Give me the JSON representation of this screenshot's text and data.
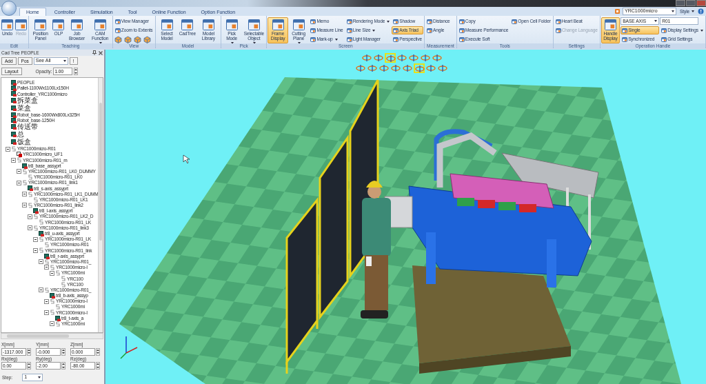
{
  "app_bar": {
    "controller": "YRC1000micro",
    "style": "Style"
  },
  "tabs": [
    {
      "label": "Home",
      "selected": true
    },
    {
      "label": "Controller",
      "selected": false
    },
    {
      "label": "Simulation",
      "selected": false
    },
    {
      "label": "Tool",
      "selected": false
    },
    {
      "label": "Online Function",
      "selected": false
    },
    {
      "label": "Option Function",
      "selected": false
    }
  ],
  "ribbon": [
    {
      "label": "Edit",
      "items": [
        {
          "label": "Undo",
          "kind": "large",
          "disabled": false
        },
        {
          "label": "Redo",
          "kind": "large",
          "disabled": true
        }
      ]
    },
    {
      "label": "Teaching",
      "items": [
        {
          "label": "Position Panel",
          "kind": "large"
        },
        {
          "label": "OLP",
          "kind": "large"
        },
        {
          "label": "Job Browser",
          "kind": "large"
        },
        {
          "label": "CAM Function",
          "kind": "large",
          "menu": true
        }
      ]
    },
    {
      "label": "View",
      "items": [
        {
          "label": "View Manager",
          "kind": "small"
        },
        {
          "label": "Zoom to Extents",
          "kind": "small"
        },
        {
          "kind": "icons"
        }
      ]
    },
    {
      "label": "Model",
      "items": [
        {
          "label": "Select Model",
          "kind": "large"
        },
        {
          "label": "CadTree",
          "kind": "large"
        },
        {
          "label": "Model Library",
          "kind": "large"
        }
      ]
    },
    {
      "label": "Pick",
      "items": [
        {
          "label": "Pick Mode",
          "kind": "large",
          "menu": true
        },
        {
          "label": "Selectable Object",
          "kind": "large",
          "menu": true
        }
      ]
    },
    {
      "label": "Screen",
      "items": [
        {
          "label": "Frame Display",
          "kind": "large",
          "selected": true
        },
        {
          "label": "Cutting Plane",
          "kind": "large",
          "menu": true
        },
        {
          "label": "Memo",
          "kind": "small"
        },
        {
          "label": "Measure Line",
          "kind": "small"
        },
        {
          "label": "Mark-up",
          "kind": "small",
          "menu": true
        },
        {
          "label": "Rendering Mode",
          "kind": "small",
          "menu": true
        },
        {
          "label": "Line Size",
          "kind": "small",
          "menu": true
        },
        {
          "label": "Light Manager",
          "kind": "small"
        },
        {
          "label": "Shadow",
          "kind": "small",
          "selected": false
        },
        {
          "label": "Axis Triad",
          "kind": "small",
          "selected": true
        },
        {
          "label": "Perspective",
          "kind": "small",
          "selected": false
        }
      ]
    },
    {
      "label": "Measurement",
      "items": [
        {
          "label": "Distance",
          "kind": "small"
        },
        {
          "label": "Angle",
          "kind": "small"
        }
      ]
    },
    {
      "label": "Tools",
      "items": [
        {
          "label": "Copy",
          "kind": "small"
        },
        {
          "label": "Measure Performance",
          "kind": "small"
        },
        {
          "label": "Execute Soft",
          "kind": "small"
        },
        {
          "label": "Open Cell Folder",
          "kind": "small"
        }
      ]
    },
    {
      "label": "Settings",
      "items": [
        {
          "label": "Heart Beat",
          "kind": "small",
          "disabled": false
        },
        {
          "label": "Change Language",
          "kind": "small",
          "disabled": true
        }
      ]
    },
    {
      "label": "Operation Handle",
      "items": [
        {
          "label": "Handle Display",
          "kind": "large",
          "selected": true
        },
        {
          "label": "BASE AXIS",
          "kind": "combo"
        },
        {
          "label": "Single",
          "kind": "small",
          "selected": true
        },
        {
          "label": "Synchronized",
          "kind": "small",
          "selected": false
        },
        {
          "label": "R01",
          "kind": "field"
        },
        {
          "label": "Display Settings",
          "kind": "small",
          "menu": true
        },
        {
          "label": "Grid Settings",
          "kind": "small"
        }
      ]
    }
  ],
  "cad_tree": {
    "title": "Cad Tree PEOPLE",
    "add": "Add",
    "pos": "Pos",
    "filter": "See All",
    "info": "!",
    "layout": "Layout",
    "opacity_label": "Opacity:",
    "opacity": "1.00",
    "items": [
      {
        "label": "PEOPLE",
        "kind": "part"
      },
      {
        "label": "Pallet-1100Wx1100Lx150H",
        "kind": "part"
      },
      {
        "label": "Controller_YRC1000micro",
        "kind": "part"
      },
      {
        "label": "拆菜盒",
        "kind": "part"
      },
      {
        "label": "菜盒",
        "kind": "part"
      },
      {
        "label": "Robot_base-1600Wx800Lx325H",
        "kind": "part"
      },
      {
        "label": "Robot_base-1250H",
        "kind": "part"
      },
      {
        "label": "传送带",
        "kind": "part"
      },
      {
        "label": "总",
        "kind": "part"
      },
      {
        "label": "饭盒",
        "kind": "part"
      },
      {
        "label": "YRC1000micro-R01",
        "kind": "frame",
        "expanded": true,
        "children": [
          {
            "label": "YRC1000micro_UF1",
            "kind": "user-frame"
          },
          {
            "label": "YRC1000micro-R01_m",
            "kind": "frame",
            "expanded": true,
            "children": [
              {
                "label": "tr8_base_assyprt",
                "kind": "part"
              },
              {
                "label": "YRC1000micro-R01_LK0_DUMMY",
                "kind": "frame",
                "expanded": true,
                "children": [
                  {
                    "label": "YRC1000micro-R01_LK0",
                    "kind": "frame"
                  }
                ]
              },
              {
                "label": "YRC1000micro-R01_link1",
                "kind": "frame",
                "expanded": true,
                "children": [
                  {
                    "label": "tr8_s-axis_assyprt",
                    "kind": "part"
                  },
                  {
                    "label": "YRC1000micro-R01_LK1_DUMM",
                    "kind": "frame",
                    "expanded": true,
                    "children": [
                      {
                        "label": "YRC1000micro-R01_LK1",
                        "kind": "frame"
                      }
                    ]
                  },
                  {
                    "label": "YRC1000micro-R01_link2",
                    "kind": "frame",
                    "expanded": true,
                    "children": [
                      {
                        "label": "tr8_l-axis_assyprt",
                        "kind": "part"
                      },
                      {
                        "label": "YRC1000micro-R01_LK2_D",
                        "kind": "frame",
                        "expanded": true,
                        "children": [
                          {
                            "label": "YRC1000micro-R01_LK",
                            "kind": "frame"
                          }
                        ]
                      },
                      {
                        "label": "YRC1000micro-R01_link3",
                        "kind": "frame",
                        "expanded": true,
                        "children": [
                          {
                            "label": "tr8_u-axis_assyprt",
                            "kind": "part"
                          },
                          {
                            "label": "YRC1000micro-R01_LK",
                            "kind": "frame",
                            "expanded": true,
                            "children": [
                              {
                                "label": "YRC1000micro-R01",
                                "kind": "frame"
                              }
                            ]
                          },
                          {
                            "label": "YRC1000micro-R01_link",
                            "kind": "frame",
                            "expanded": true,
                            "children": [
                              {
                                "label": "tr8_r-axis_assyprt",
                                "kind": "part"
                              },
                              {
                                "label": "YRC1000micro-R01_",
                                "kind": "frame",
                                "expanded": true,
                                "children": [
                                  {
                                    "label": "YRC1000micro-I",
                                    "kind": "frame",
                                    "expanded": true,
                                    "children": [
                                      {
                                        "label": "YRC1000mi",
                                        "kind": "frame",
                                        "expanded": true,
                                        "children": [
                                          {
                                            "label": "YRC100",
                                            "kind": "frame"
                                          },
                                          {
                                            "label": "YRC100",
                                            "kind": "frame"
                                          }
                                        ]
                                      }
                                    ]
                                  }
                                ]
                              },
                              {
                                "label": "YRC1000micro-R01_",
                                "kind": "frame",
                                "expanded": true,
                                "children": [
                                  {
                                    "label": "tr8_b-axis_assyp",
                                    "kind": "part"
                                  },
                                  {
                                    "label": "YRC1000micro-I",
                                    "kind": "frame",
                                    "expanded": true,
                                    "children": [
                                      {
                                        "label": "YRC1000mi",
                                        "kind": "frame"
                                      }
                                    ]
                                  },
                                  {
                                    "label": "YRC1000micro-I",
                                    "kind": "frame",
                                    "expanded": true,
                                    "children": [
                                      {
                                        "label": "tr8_t-axis_a",
                                        "kind": "part"
                                      },
                                      {
                                        "label": "YRC1000mi",
                                        "kind": "frame",
                                        "expanded": true
                                      }
                                    ]
                                  }
                                ]
                              }
                            ]
                          }
                        ]
                      }
                    ]
                  }
                ]
              }
            ]
          }
        ]
      }
    ]
  },
  "position": {
    "fields": [
      {
        "label": "X[mm]",
        "value": "-1317.000"
      },
      {
        "label": "Y[mm]",
        "value": "-0.000"
      },
      {
        "label": "Z[mm]",
        "value": "0.000"
      },
      {
        "label": "Rx(deg)",
        "value": "0.00"
      },
      {
        "label": "Ry(deg)",
        "value": "-2.00"
      },
      {
        "label": "Rz(deg)",
        "value": "-80.00"
      }
    ],
    "step_label": "Step:",
    "step": "1"
  },
  "view_toolbar": [
    [
      {
        "selected": false
      },
      {
        "selected": false
      },
      {
        "selected": true
      },
      {
        "selected": false
      },
      {
        "selected": false
      },
      {
        "selected": false
      },
      {
        "selected": false
      }
    ],
    [
      {
        "selected": false
      },
      {
        "selected": false
      },
      {
        "selected": false
      },
      {
        "selected": false
      },
      {
        "selected": false
      },
      {
        "selected": true
      },
      {
        "selected": false
      },
      {
        "selected": false
      }
    ]
  ]
}
